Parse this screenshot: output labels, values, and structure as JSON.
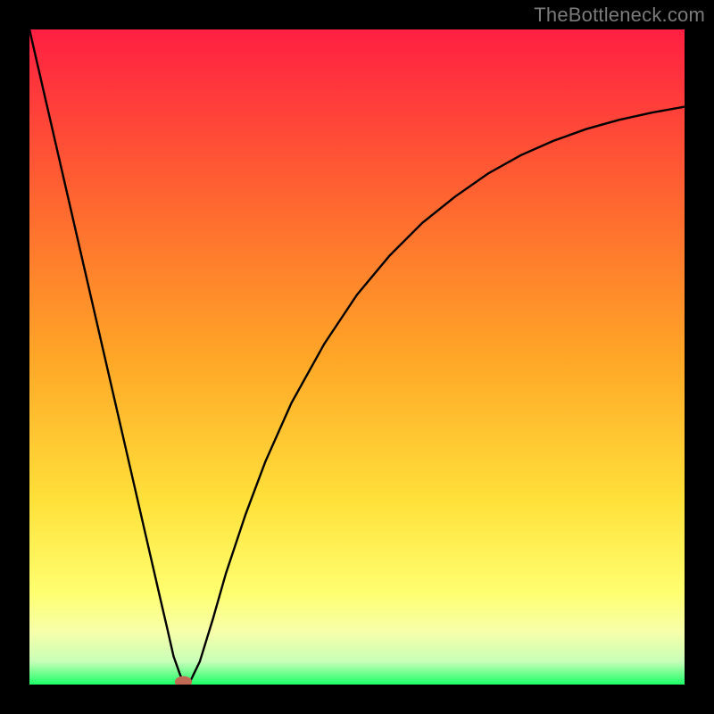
{
  "watermark": "TheBottleneck.com",
  "chart_data": {
    "type": "line",
    "title": "",
    "xlabel": "",
    "ylabel": "",
    "xlim": [
      0,
      100
    ],
    "ylim": [
      0,
      100
    ],
    "grid": false,
    "legend": false,
    "background_gradient": {
      "stops": [
        {
          "offset": 0.0,
          "color": "#ff1f42"
        },
        {
          "offset": 0.28,
          "color": "#ff6b2f"
        },
        {
          "offset": 0.5,
          "color": "#ffa627"
        },
        {
          "offset": 0.72,
          "color": "#ffe13a"
        },
        {
          "offset": 0.86,
          "color": "#ffff70"
        },
        {
          "offset": 0.92,
          "color": "#f7ffaa"
        },
        {
          "offset": 0.965,
          "color": "#c8ffb8"
        },
        {
          "offset": 1.0,
          "color": "#1aff66"
        }
      ]
    },
    "series": [
      {
        "name": "bottleneck-curve",
        "color": "#000000",
        "stroke_width": 2.4,
        "x": [
          0,
          2,
          4,
          6,
          8,
          10,
          12,
          14,
          16,
          18,
          20,
          21,
          22,
          23,
          23.5,
          24.5,
          26,
          28,
          30,
          33,
          36,
          40,
          45,
          50,
          55,
          60,
          65,
          70,
          75,
          80,
          85,
          90,
          95,
          100
        ],
        "y": [
          100,
          91.3,
          82.6,
          73.9,
          65.2,
          56.5,
          47.8,
          39.1,
          30.4,
          21.7,
          13.0,
          8.7,
          4.3,
          1.5,
          0.4,
          0.4,
          3.5,
          10.0,
          17.0,
          26.0,
          34.0,
          43.0,
          52.0,
          59.5,
          65.5,
          70.5,
          74.5,
          78.0,
          80.8,
          83.0,
          84.8,
          86.2,
          87.3,
          88.2
        ]
      }
    ],
    "marker": {
      "x": 23.5,
      "y": 0.4,
      "rx": 1.3,
      "ry": 0.9,
      "color": "#c06a55"
    }
  }
}
